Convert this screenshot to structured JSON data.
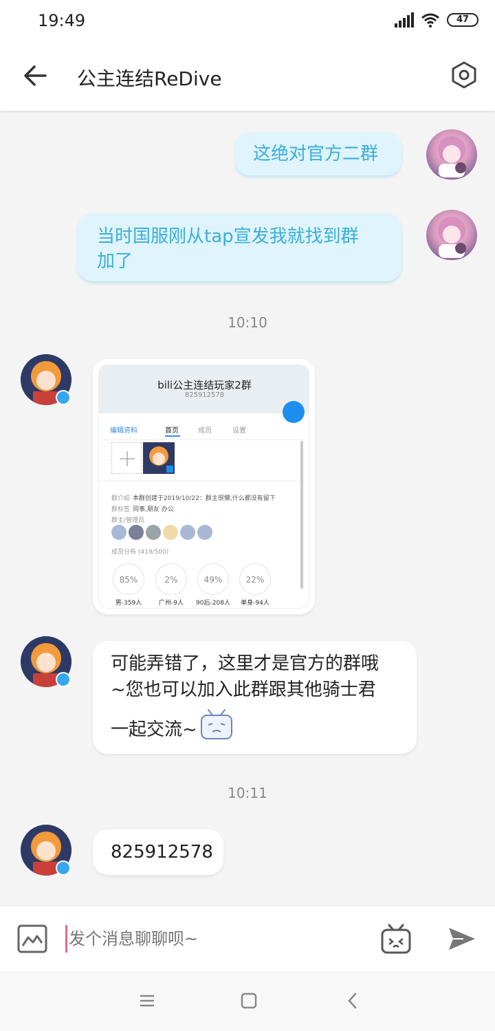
{
  "status_bar": {
    "time": "19:49",
    "battery": "47"
  },
  "header": {
    "title": "公主连结ReDive"
  },
  "messages": {
    "m1": "这绝对官方二群",
    "m2_line1": "当时国服刚从tap宣发我就找到群",
    "m2_line2": "加了",
    "ts1": "10:10",
    "card": {
      "title": "bili公主连结玩家2群",
      "id": "825912578",
      "tabs": [
        "编辑资料",
        "首页",
        "成员",
        "设置"
      ],
      "intro_label": "群介绍",
      "intro": "本群创建于2019/10/22：群主很懒,什么都没有留下",
      "tags_label": "群标签",
      "tags": "同事,朋友  办公",
      "admins_label": "群主/管理员",
      "dist_label": "成员分布 (419/500)",
      "stats": [
        {
          "pct": "85%",
          "caption": "男-359人"
        },
        {
          "pct": "2%",
          "caption": "广州-9人"
        },
        {
          "pct": "49%",
          "caption": "90后-208人"
        },
        {
          "pct": "22%",
          "caption": "单身-94人"
        }
      ]
    },
    "m3_line1": "可能弄错了，这里才是官方的群哦",
    "m3_line2": "~您也可以加入此群跟其他骑士君",
    "m3_line3": "一起交流~",
    "ts2": "10:11",
    "m4": "825912578"
  },
  "input": {
    "placeholder": "发个消息聊聊呗~"
  },
  "colors": {
    "accent": "#35a7ef",
    "bubble_out_bg": "#dff4fd",
    "bubble_out_text": "#3aaedb"
  },
  "icons": [
    "back-arrow-icon",
    "settings-hexagon-icon",
    "image-icon",
    "emoji-tv-icon",
    "send-icon",
    "menu-icon",
    "home-square-icon",
    "nav-back-icon"
  ]
}
